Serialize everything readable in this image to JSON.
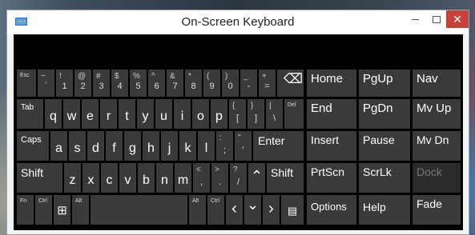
{
  "window": {
    "title": "On-Screen Keyboard",
    "min_icon": "minimize-icon",
    "max_icon": "maximize-icon",
    "close_icon": "close-icon",
    "app_icon": "keyboard-icon"
  },
  "keys": {
    "esc": "Esc",
    "tilde_shift": "~",
    "tilde": "`",
    "n1s": "!",
    "n1": "1",
    "n2s": "@",
    "n2": "2",
    "n3s": "#",
    "n3": "3",
    "n4s": "$",
    "n4": "4",
    "n5s": "%",
    "n5": "5",
    "n6s": "^",
    "n6": "6",
    "n7s": "&",
    "n7": "7",
    "n8s": "*",
    "n8": "8",
    "n9s": "(",
    "n9": "9",
    "n0s": ")",
    "n0": "0",
    "minus_s": "_",
    "minus": "-",
    "plus_s": "+",
    "plus": "=",
    "backspace": "⌫",
    "tab": "Tab",
    "q": "q",
    "w": "w",
    "e": "e",
    "r": "r",
    "t": "t",
    "y": "y",
    "u": "u",
    "i": "i",
    "o": "o",
    "p": "p",
    "lb_s": "{",
    "lb": "[",
    "rb_s": "}",
    "rb": "]",
    "bs_s": "|",
    "bs": "\\",
    "del": "Del",
    "caps": "Caps",
    "a": "a",
    "s": "s",
    "d": "d",
    "f": "f",
    "g": "g",
    "h": "h",
    "j": "j",
    "k": "k",
    "l": "l",
    "semi_s": ":",
    "semi": ";",
    "quote_s": "\"",
    "quote": "'",
    "enter": "Enter",
    "lshift": "Shift",
    "z": "z",
    "x": "x",
    "c": "c",
    "v": "v",
    "b": "b",
    "n": "n",
    "m": "m",
    "comma_s": "<",
    "comma": ",",
    "period_s": ">",
    "period": ".",
    "slash_s": "?",
    "slash": "/",
    "up": "⌃",
    "rshift": "Shift",
    "fn": "Fn",
    "lctrl": "Ctrl",
    "win": "⊞",
    "lalt": "Alt",
    "ralt": "Alt",
    "rctrl": "Ctrl",
    "left": "‹",
    "down": "⌄",
    "right": "›",
    "menu": "▤"
  },
  "nav_keys": {
    "home": "Home",
    "pgup": "PgUp",
    "nav": "Nav",
    "end": "End",
    "pgdn": "PgDn",
    "mvup": "Mv Up",
    "insert": "Insert",
    "pause": "Pause",
    "mvdn": "Mv Dn",
    "prtscn": "PrtScn",
    "scrlk": "ScrLk",
    "dock": "Dock",
    "options": "Options",
    "help": "Help",
    "fade": "Fade"
  }
}
